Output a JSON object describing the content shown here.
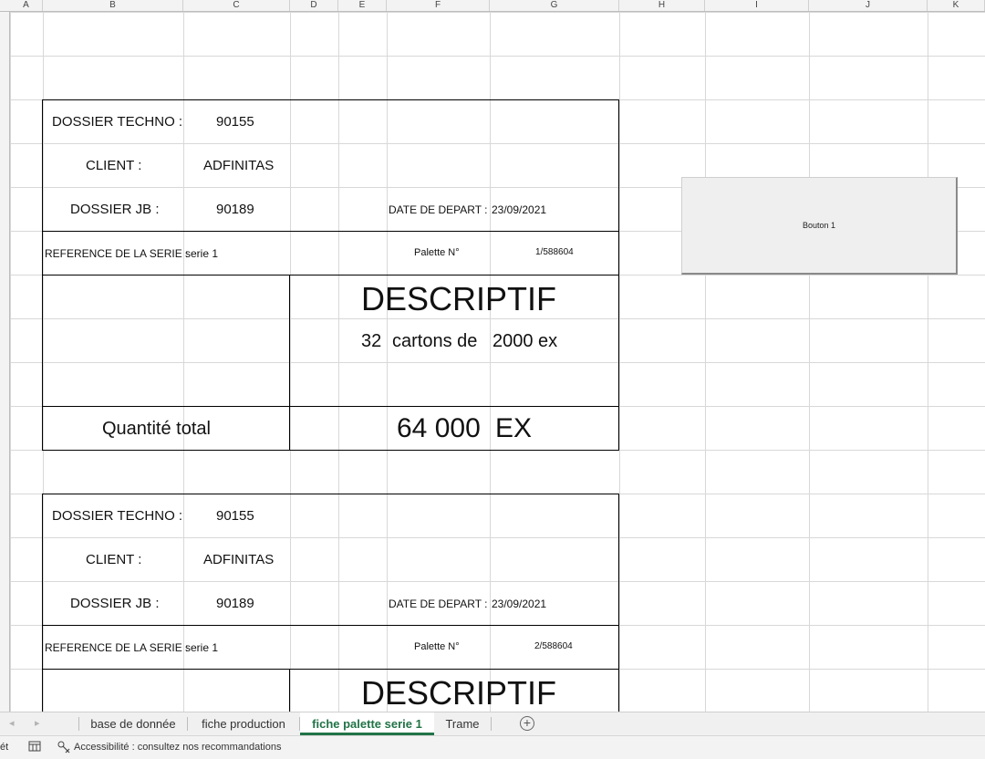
{
  "columns": [
    "A",
    "B",
    "C",
    "D",
    "E",
    "F",
    "G",
    "H",
    "I",
    "J",
    "K"
  ],
  "sheet_blocks": [
    {
      "dossier_techno_label": "DOSSIER TECHNO :",
      "dossier_techno_value": "90155",
      "client_label": "CLIENT :",
      "client_value": "ADFINITAS",
      "dossier_jb_label": "DOSSIER JB :",
      "dossier_jb_value": "90189",
      "date_depart_label": "DATE DE DEPART :",
      "date_depart_value": "23/09/2021",
      "reference_label": "REFERENCE DE LA SERIE :",
      "reference_value": "serie 1",
      "palette_label": "Palette N°",
      "palette_value": "1/588604",
      "descriptif_title": "DESCRIPTIF",
      "cartons_count": "32",
      "cartons_label": "cartons de",
      "cartons_ex": "2000 ex",
      "quantite_label": "Quantité total",
      "quantite_value": "64 000",
      "quantite_unit": "EX"
    },
    {
      "dossier_techno_label": "DOSSIER TECHNO :",
      "dossier_techno_value": "90155",
      "client_label": "CLIENT :",
      "client_value": "ADFINITAS",
      "dossier_jb_label": "DOSSIER JB :",
      "dossier_jb_value": "90189",
      "date_depart_label": "DATE DE DEPART :",
      "date_depart_value": "23/09/2021",
      "reference_label": "REFERENCE DE LA SERIE :",
      "reference_value": "serie 1",
      "palette_label": "Palette N°",
      "palette_value": "2/588604",
      "descriptif_title": "DESCRIPTIF"
    }
  ],
  "macro_button": {
    "label": "Bouton 1"
  },
  "tabs": [
    {
      "label": "base de donnée",
      "active": false
    },
    {
      "label": "fiche production",
      "active": false
    },
    {
      "label": "fiche palette serie 1",
      "active": true
    },
    {
      "label": "Trame",
      "active": false
    }
  ],
  "tab_nav": {
    "prev": "◂",
    "next": "▸",
    "add": "+"
  },
  "status": {
    "ready_fragment": "ét",
    "accessibility": "Accessibilité : consultez nos recommandations"
  },
  "colors": {
    "accent": "#217346",
    "gridline": "#d8d8d8",
    "border": "#000000"
  }
}
